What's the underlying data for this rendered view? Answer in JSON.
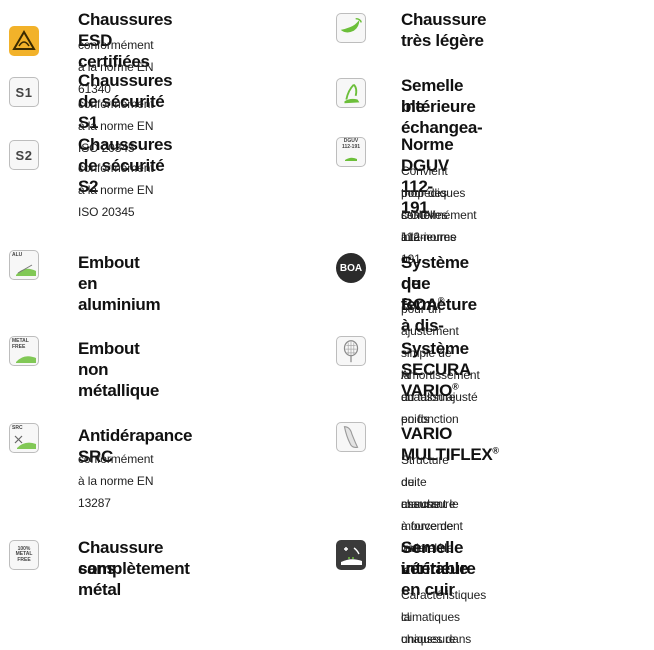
{
  "left": [
    {
      "title": "Chaussures ESD certifiées",
      "desc": "conformément à la norme EN 61340",
      "icon": "esd-icon"
    },
    {
      "title": "Chaussures de sécurité S1",
      "desc": "conformément à la norme EN ISO 20345",
      "icon": "s1-icon",
      "icon_text": "S1"
    },
    {
      "title": "Chaussures de sécurité S2",
      "desc": "conformément à la norme EN ISO 20345",
      "icon": "s2-icon",
      "icon_text": "S2"
    },
    {
      "title": "Embout en aluminium",
      "icon": "alu-toecap-icon",
      "icon_text": "ALU"
    },
    {
      "title": "Embout non métallique",
      "icon": "metal-free-toecap-icon",
      "icon_text": "METAL FREE"
    },
    {
      "title": "Antidérapance SRC",
      "desc": "conformément à la norme EN 13287",
      "icon": "src-slip-resistance-icon",
      "icon_text": "SRC"
    },
    {
      "title_line1": "Chaussure complètement",
      "title_line2": "sans métal",
      "icon": "100-metal-free-icon",
      "icon_text_1": "100%",
      "icon_text_2": "METAL",
      "icon_text_3": "FREE"
    }
  ],
  "right": [
    {
      "title": "Chaussure très légère",
      "icon": "lightweight-shoe-icon"
    },
    {
      "title_line1": "Semelle intérieure échangea-",
      "title_line2": "ble",
      "icon": "exchangeable-insole-icon"
    },
    {
      "title": "Norme DGUV 112-191",
      "desc_lines": [
        "Convient pour des semelles intérieures or-",
        "thopédiques conformément à la norme",
        "DGUV 112-191"
      ],
      "icon": "dguv-icon",
      "icon_text_1": "DGUV",
      "icon_text_2": "112-191"
    },
    {
      "title_line1": "Système de fermeture à dis-",
      "title_line2_main": "que BOA",
      "title_line2_sup": "®",
      "desc": "pour un ajustement simple de la chaussure",
      "icon": "boa-icon",
      "icon_text": "BOA"
    },
    {
      "title_main": "Système SECURA VARIO",
      "title_sup": "®",
      "desc_lines": [
        "Amortissement au talon ajusté en fonction",
        "du poids"
      ],
      "icon": "heel-cushion-icon"
    },
    {
      "title_main": "VARIO MULTIFLEX",
      "title_sup": "®",
      "desc_lines": [
        "Structure de chaussure à force de levier ré-",
        "duite assurant le mouvement naturel de la",
        "marche"
      ],
      "icon": "multiflex-sole-icon"
    },
    {
      "title_line1": "Semelle intérieure en cuir",
      "title_line2": "véritable",
      "desc_lines": [
        "Caractéristiques climatiques uniques dans",
        "la chaussure"
      ],
      "icon": "leather-insole-icon"
    }
  ],
  "colors": {
    "esd_yellow": "#f2b22a",
    "green": "#6cbf3a",
    "icon_gray": "#9a9a9a"
  }
}
